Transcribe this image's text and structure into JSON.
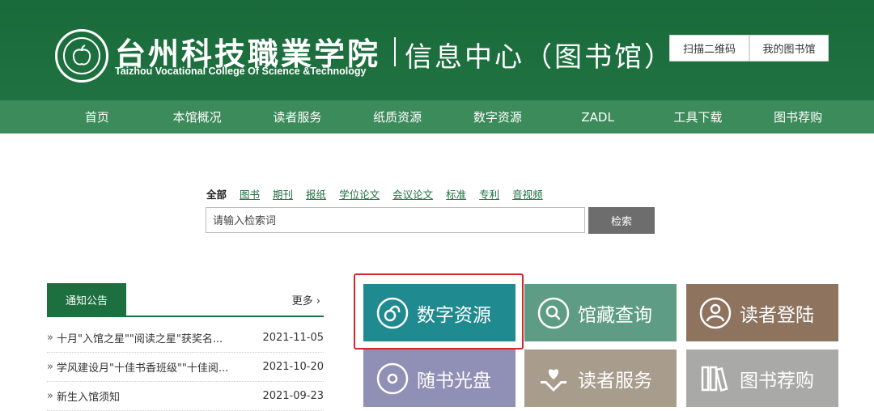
{
  "header": {
    "college_cn": "台州科技職業学院",
    "college_en": "Taizhou Vocational College Of Science &Technology",
    "center_title": "信息中心（图书馆）",
    "buttons": [
      "扫描二维码",
      "我的图书馆"
    ]
  },
  "nav": {
    "items": [
      "首页",
      "本馆概况",
      "读者服务",
      "纸质资源",
      "数字资源",
      "ZADL",
      "工具下载",
      "图书荐购"
    ]
  },
  "search": {
    "tabs": [
      "全部",
      "图书",
      "期刊",
      "报纸",
      "学位论文",
      "会议论文",
      "标准",
      "专利",
      "音视频"
    ],
    "active_tab": "全部",
    "placeholder": "请输入检索词",
    "button_label": "检索"
  },
  "notice": {
    "title": "通知公告",
    "more": "更多 ›",
    "bullet": "»",
    "items": [
      {
        "title": "十月\"入馆之星\"\"阅读之星\"获奖名...",
        "date": "2021-11-05"
      },
      {
        "title": "学风建设月\"十佳书香班级\"\"十佳阅...",
        "date": "2021-10-20"
      },
      {
        "title": "新生入馆须知",
        "date": "2021-09-23"
      }
    ]
  },
  "tiles": [
    {
      "label": "数字资源",
      "icon": "digital-resource-icon",
      "color": "#1f8a8f"
    },
    {
      "label": "馆藏查询",
      "icon": "search-icon",
      "color": "#5e9c86"
    },
    {
      "label": "读者登陆",
      "icon": "user-icon",
      "color": "#8e735f"
    },
    {
      "label": "随书光盘",
      "icon": "disc-icon",
      "color": "#908fb5"
    },
    {
      "label": "读者服务",
      "icon": "heart-hand-icon",
      "color": "#a89c8c"
    },
    {
      "label": "图书荐购",
      "icon": "books-icon",
      "color": "#a9a9a7"
    }
  ],
  "colors": {
    "brand_green": "#1e6f3f",
    "nav_green": "#3c8b5a",
    "highlight_red": "#d9262c"
  }
}
